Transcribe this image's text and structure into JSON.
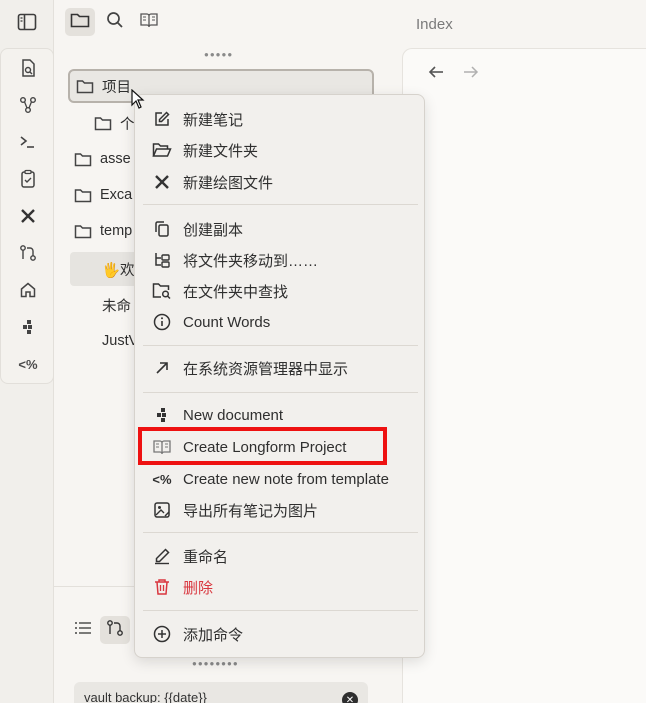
{
  "editor": {
    "title": "Index",
    "back_icon": "arrow-left-icon",
    "forward_icon": "arrow-right-icon"
  },
  "ribbon": {
    "toggle_sidebar_icon": "sidebar-toggle-icon",
    "items": [
      {
        "icon": "open-quick-switcher-icon"
      },
      {
        "icon": "graph-view-icon"
      },
      {
        "icon": "terminal-icon"
      },
      {
        "icon": "clipboard-icon"
      },
      {
        "icon": "excalidraw-icon"
      },
      {
        "icon": "git-branch-icon"
      },
      {
        "icon": "home-icon"
      },
      {
        "icon": "blocks-icon"
      },
      {
        "icon": "templater-icon",
        "text": "<%"
      }
    ]
  },
  "explorer": {
    "tabs": [
      {
        "icon": "folder-icon",
        "active": true
      },
      {
        "icon": "search-icon",
        "active": false
      },
      {
        "icon": "book-icon",
        "active": false
      }
    ],
    "tree": [
      {
        "label": "项目",
        "type": "folder",
        "indent": 0,
        "selected": true
      },
      {
        "label": "个",
        "type": "folder",
        "indent": 1
      },
      {
        "label": "asse",
        "type": "folder",
        "indent": 0
      },
      {
        "label": "Exca",
        "type": "folder",
        "indent": 0
      },
      {
        "label": "temp",
        "type": "folder",
        "indent": 0
      },
      {
        "label": "🖐欢",
        "type": "note",
        "indent": 1,
        "active": true
      },
      {
        "label": "未命",
        "type": "note",
        "indent": 1
      },
      {
        "label": "JustV",
        "type": "note",
        "indent": 1
      }
    ],
    "bottom_tabs": [
      {
        "icon": "list-icon"
      },
      {
        "icon": "git-branch-icon",
        "active": true
      }
    ],
    "search_value": "vault backup: {{date}}"
  },
  "context_menu": {
    "groups": [
      [
        {
          "label": "新建笔记",
          "icon": "edit-icon"
        },
        {
          "label": "新建文件夹",
          "icon": "folder-open-icon"
        },
        {
          "label": "新建绘图文件",
          "icon": "excalidraw-icon"
        }
      ],
      [
        {
          "label": "创建副本",
          "icon": "copy-icon"
        },
        {
          "label": "将文件夹移动到……",
          "icon": "folder-tree-icon"
        },
        {
          "label": "在文件夹中查找",
          "icon": "folder-search-icon"
        },
        {
          "label": "Count Words",
          "icon": "info-icon"
        }
      ],
      [
        {
          "label": "在系统资源管理器中显示",
          "icon": "arrow-up-right-icon"
        }
      ],
      [
        {
          "label": "New document",
          "icon": "blocks-icon"
        },
        {
          "label": "Create Longform Project",
          "icon": "book-open-icon",
          "highlighted": true
        },
        {
          "label": "Create new note from template",
          "icon": "templater-icon",
          "icon_text": "<%"
        },
        {
          "label": "导出所有笔记为图片",
          "icon": "image-export-icon"
        }
      ],
      [
        {
          "label": "重命名",
          "icon": "pencil-icon"
        },
        {
          "label": "删除",
          "icon": "trash-icon",
          "danger": true
        }
      ],
      [
        {
          "label": "添加命令",
          "icon": "plus-circle-icon"
        }
      ]
    ]
  },
  "colors": {
    "highlight": "#ee1111",
    "danger": "#d9363e"
  }
}
